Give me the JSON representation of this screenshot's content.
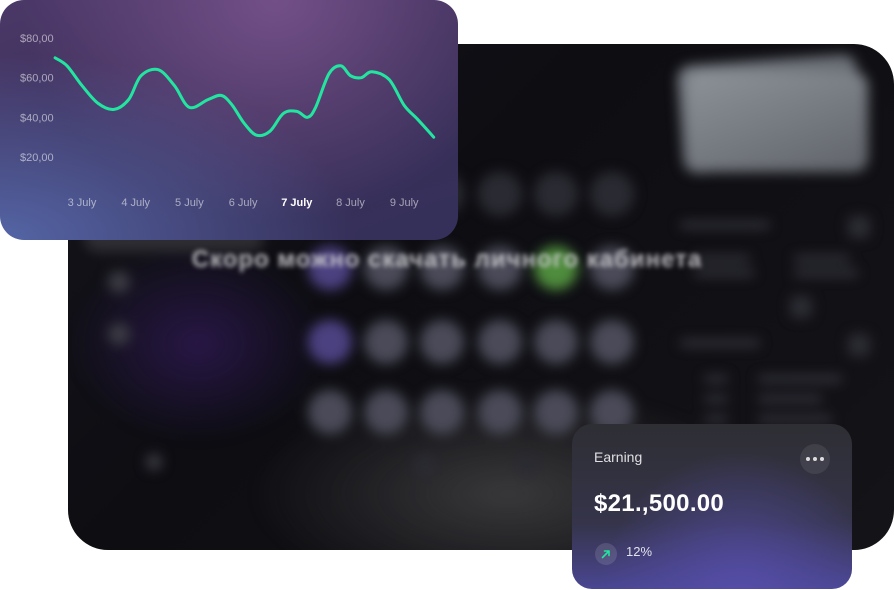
{
  "background_dashboard": {
    "headline": "Скоро можно скачать личного кабинета"
  },
  "chart_card": {
    "chart_data": {
      "type": "line",
      "categories": [
        "3 July",
        "4 July",
        "5 July",
        "6 July",
        "7 July",
        "8 July",
        "9 July"
      ],
      "selected_category": "7 July",
      "y_ticks": [
        "$80,00",
        "$60,00",
        "$40,00",
        "$20,00"
      ],
      "ylim": [
        20,
        80
      ],
      "series": [
        {
          "color": "#22e6a0",
          "x": [
            2.5,
            2.72,
            3.0,
            3.3,
            3.6,
            3.87,
            4.1,
            4.42,
            4.72,
            5.0,
            5.35,
            5.6,
            5.8,
            6.02,
            6.25,
            6.5,
            6.75,
            7.0,
            7.2,
            7.35,
            7.6,
            7.82,
            8.0,
            8.2,
            8.4,
            8.72,
            9.0,
            9.25,
            9.55
          ],
          "values": [
            70,
            66,
            56,
            47,
            44,
            49,
            61,
            64,
            56,
            45,
            49,
            51,
            46,
            37,
            31,
            33,
            42,
            43,
            40,
            45,
            62,
            66,
            61,
            60,
            63,
            59,
            46,
            39,
            30
          ]
        }
      ]
    }
  },
  "earning_card": {
    "title": "Earning",
    "amount": "$21.,500.00",
    "change": "12%",
    "trend_color": "#22e6a0",
    "more_icon": "more-dots-icon",
    "trend_icon": "arrow-up-right-icon"
  }
}
